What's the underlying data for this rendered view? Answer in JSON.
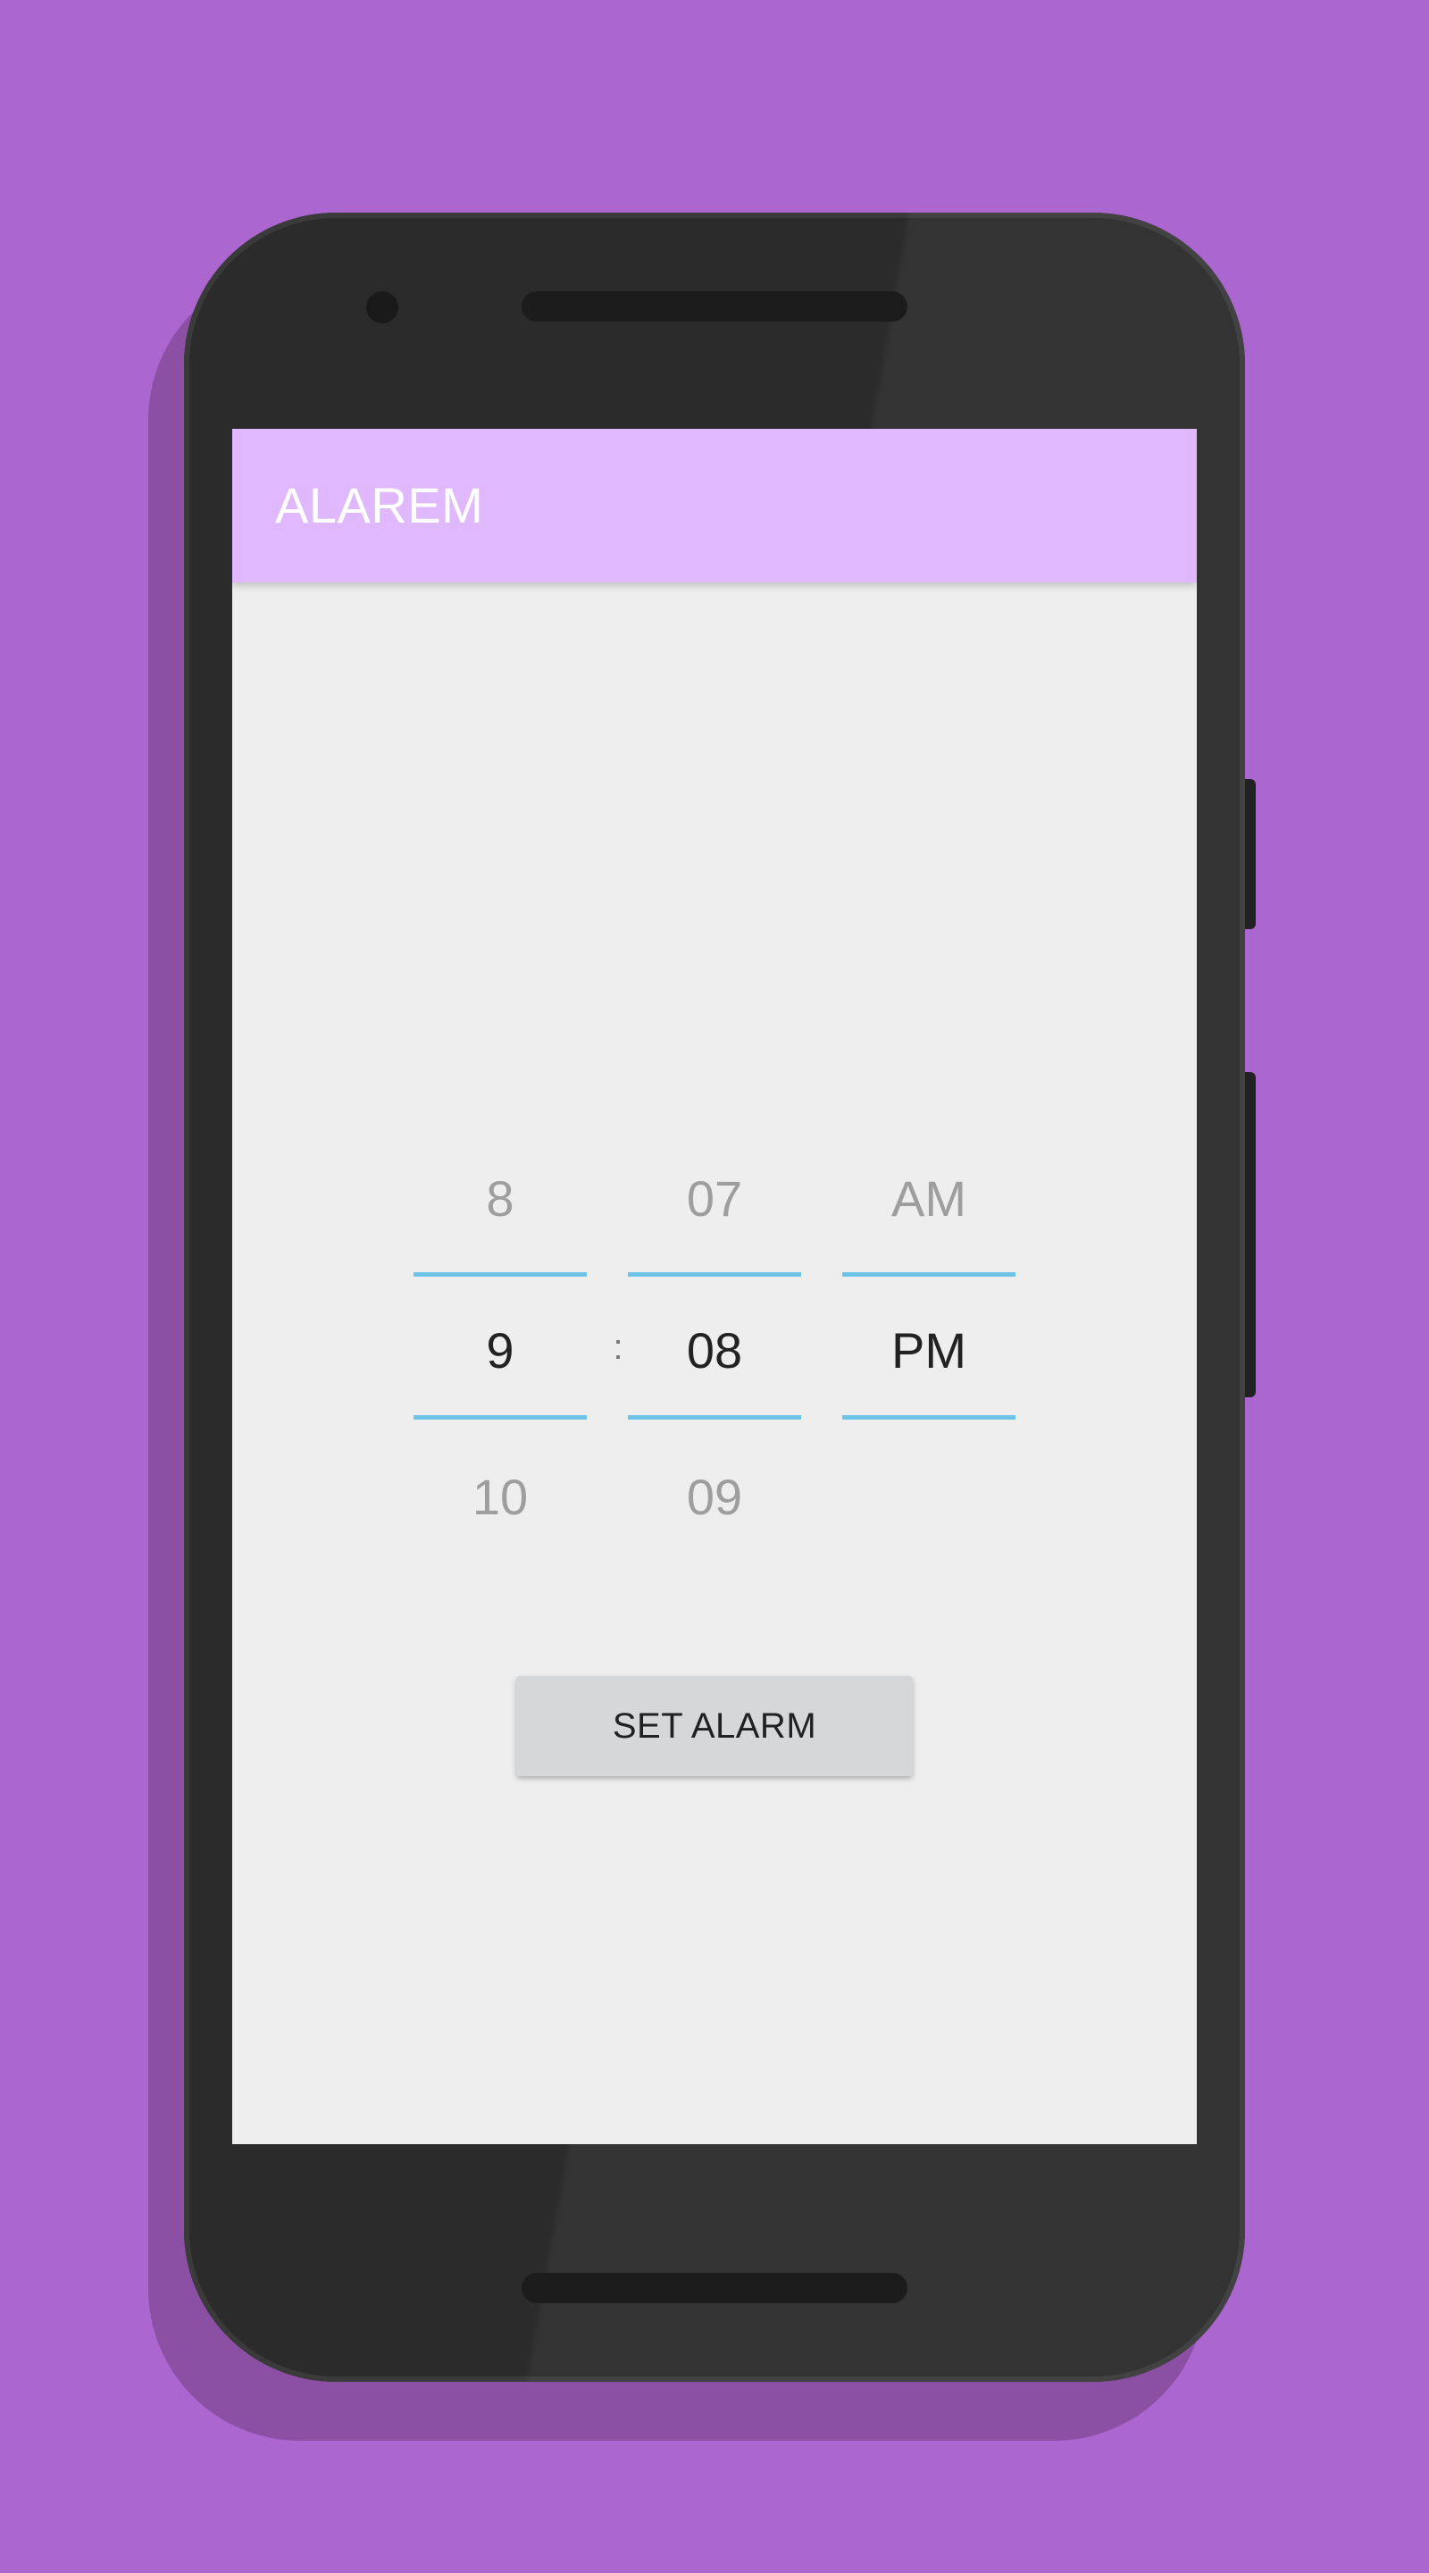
{
  "app": {
    "title": "ALAREM",
    "accent_color": "#e0b8fd",
    "background_color": "#ac66d0"
  },
  "time_picker": {
    "hour": {
      "prev": "8",
      "current": "9",
      "next": "10"
    },
    "separator": ":",
    "minute": {
      "prev": "07",
      "current": "08",
      "next": "09"
    },
    "ampm": {
      "prev": "AM",
      "current": "PM",
      "next": ""
    },
    "divider_color": "#6ec3e6"
  },
  "actions": {
    "set_alarm_label": "SET ALARM"
  }
}
